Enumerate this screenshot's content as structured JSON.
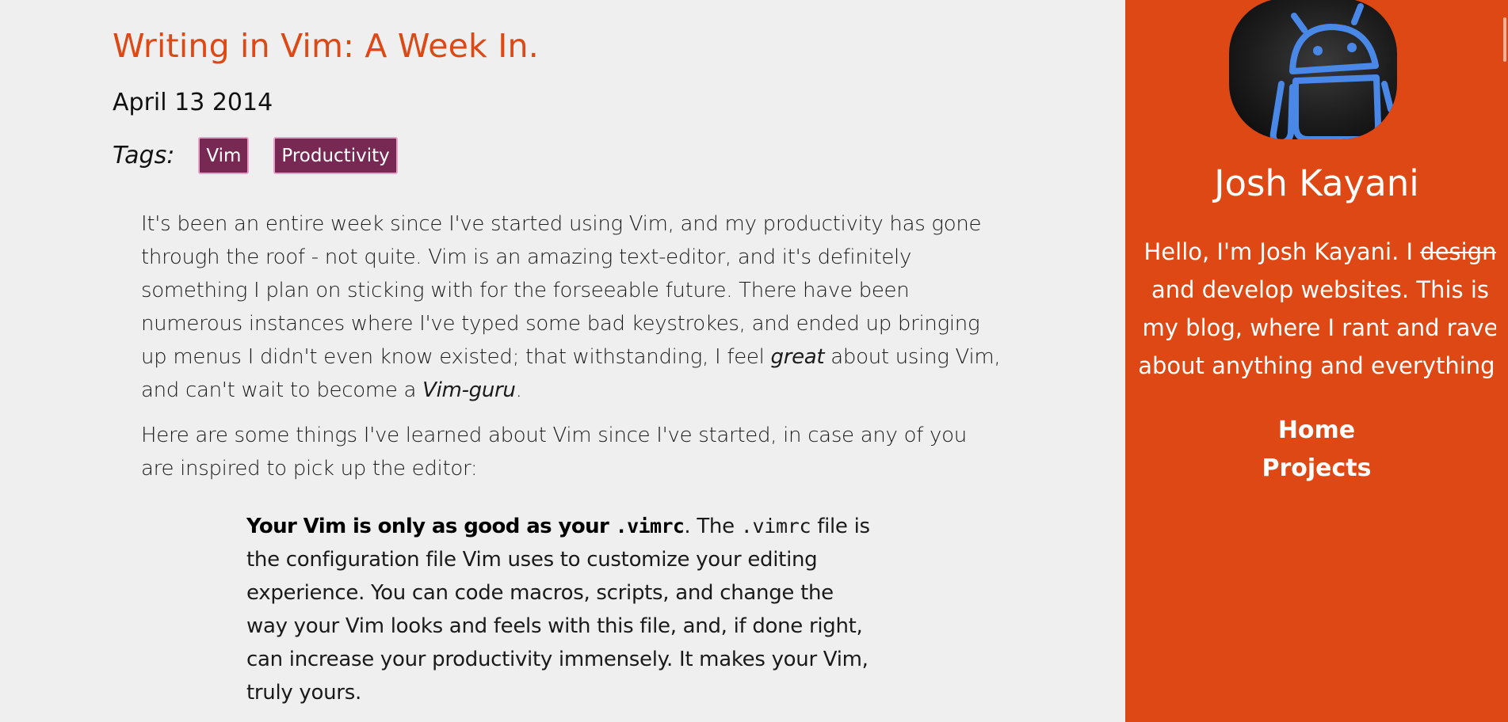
{
  "post": {
    "title": "Writing in Vim: A Week In.",
    "date": "April 13 2014",
    "tags_label": "Tags:",
    "tags": [
      "Vim",
      "Productivity"
    ],
    "p1": {
      "a": "It's been an entire week since I've started using Vim, and my productivity has gone through the roof - not quite. Vim is an amazing text-editor, and it's definitely something I plan on sticking with for the forseeable future. There have been numerous instances where I've typed some bad keystrokes, and ended up bringing up menus I didn't even know existed; that withstanding, I feel ",
      "em1": "great",
      "b": " about using Vim, and can't wait to become a ",
      "em2": "Vim-guru",
      "c": "."
    },
    "p2": "Here are some things I've learned about Vim since I've started, in case any of you are inspired to pick up the editor:",
    "tip1": {
      "strong_text": "Your Vim is only as good as your ",
      "strong_code": ".vimrc",
      "after_strong": ". The ",
      "code": ".vimrc",
      "rest": " file is the configuration file Vim uses to customize your editing experience. You can code macros, scripts, and change the way your Vim looks and feels with this file, and, if done right, can increase your productivity immensely. It makes your Vim, truly yours."
    }
  },
  "sidebar": {
    "author_name": "Josh Kayani",
    "bio": {
      "before": "Hello, I'm Josh Kayani. I ",
      "struck": "design",
      "after": " and develop websites. This is my blog, where I rant and rave about anything and everything."
    },
    "nav": [
      "Home",
      "Projects"
    ]
  },
  "colors": {
    "accent": "#dd4814",
    "tag": "#772953",
    "background": "#efefef",
    "android": "#4a88e8"
  },
  "icons": [
    "android-avatar-icon"
  ]
}
